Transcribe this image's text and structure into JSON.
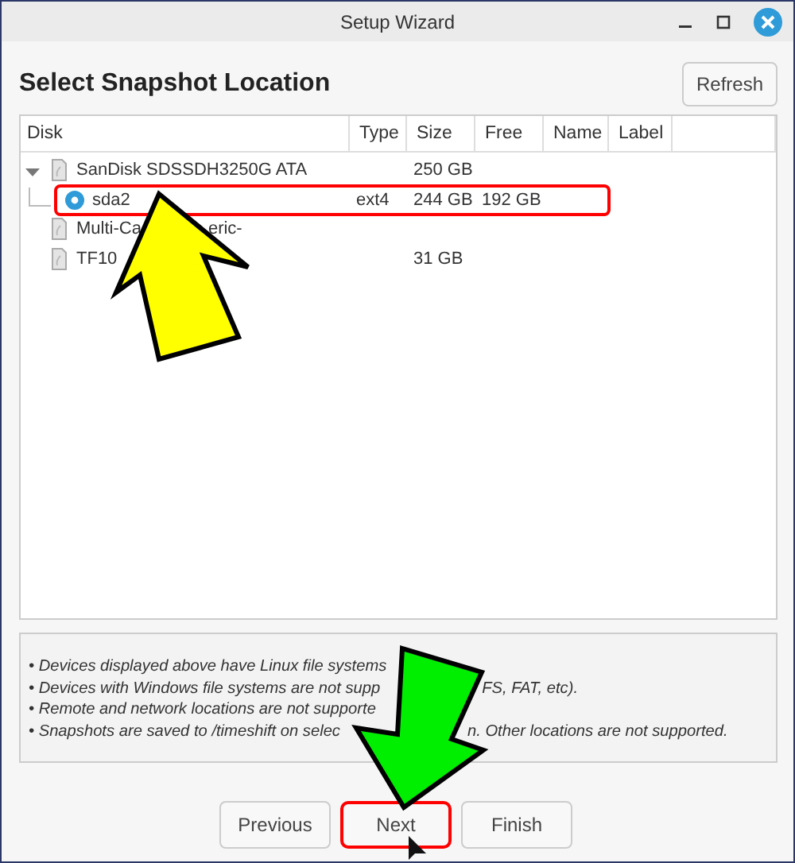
{
  "window": {
    "title": "Setup Wizard"
  },
  "heading": "Select Snapshot Location",
  "refresh_button": "Refresh",
  "table": {
    "columns": [
      "Disk",
      "Type",
      "Size",
      "Free",
      "Name",
      "Label"
    ],
    "rows": [
      {
        "kind": "disk",
        "name_parts": [
          "SanDisk SDSSDH3250G ATA"
        ],
        "size": "250 GB",
        "expanded": true,
        "children": [
          {
            "kind": "partition",
            "name_parts": [
              "sda2"
            ],
            "type": "ext4",
            "size": "244 GB",
            "free": "192 GB",
            "selected": true,
            "highlighted": true
          }
        ]
      },
      {
        "kind": "disk",
        "name_parts": [
          "Multi-Ca",
          "eric-"
        ]
      },
      {
        "kind": "disk",
        "name_parts": [
          "TF10"
        ],
        "size": "31 GB"
      }
    ]
  },
  "notes": [
    {
      "parts": [
        "• Devices displayed above have Linux file systems"
      ]
    },
    {
      "parts": [
        "• Devices with Windows file systems are not supp",
        "FS, FAT, etc)."
      ]
    },
    {
      "parts": [
        "• Remote and network locations are not supporte"
      ]
    },
    {
      "parts": [
        "• Snapshots are saved to /timeshift on selec",
        "n. Other locations are not supported."
      ]
    }
  ],
  "buttons": [
    {
      "label": "Previous",
      "highlighted": false
    },
    {
      "label": "Next",
      "highlighted": true
    },
    {
      "label": "Finish",
      "highlighted": false
    }
  ]
}
